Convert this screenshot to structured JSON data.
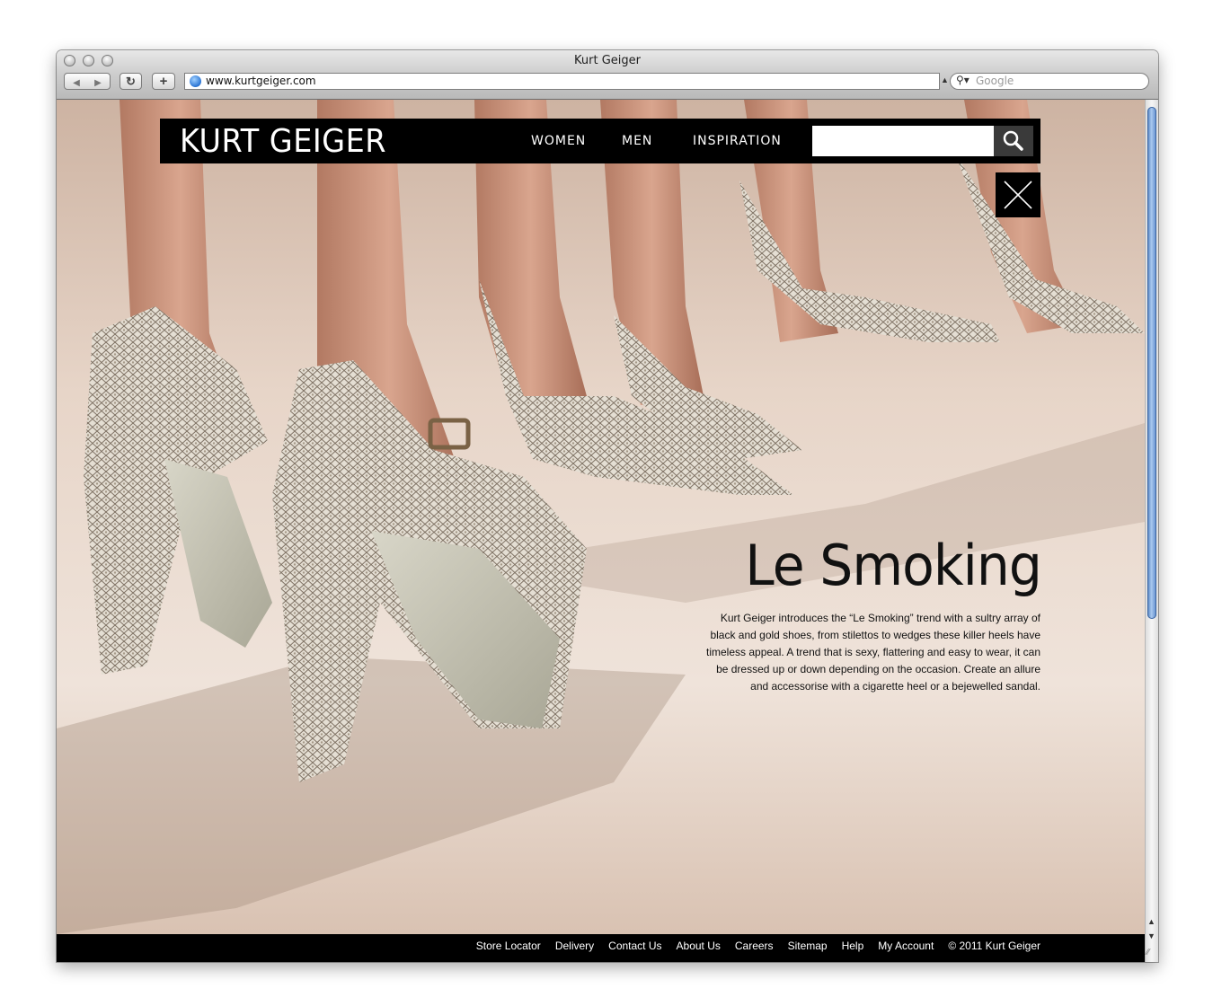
{
  "browser": {
    "window_title": "Kurt Geiger",
    "url": "www.kurtgeiger.com",
    "search_placeholder": "Google"
  },
  "site": {
    "logo": "KURT GEIGER",
    "nav": [
      "WOMEN",
      "MEN",
      "INSPIRATION"
    ]
  },
  "article": {
    "title": "Le Smoking",
    "body": "Kurt Geiger introduces the “Le Smoking” trend with a sultry array of black and gold shoes, from stilettos to wedges these killer heels have timeless appeal. A trend that is sexy, flattering and easy to wear, it can be dressed up or down depending on the occasion. Create an allure and accessorise with a cigarette heel or a bejewelled sandal."
  },
  "footer": {
    "links": [
      "Store Locator",
      "Delivery",
      "Contact Us",
      "About Us",
      "Careers",
      "Sitemap",
      "Help",
      "My Account",
      "© 2011 Kurt Geiger"
    ]
  },
  "icons": {
    "site_search": "magnifier-icon",
    "close": "close-x-icon",
    "browser_search": "magnifier-icon"
  }
}
